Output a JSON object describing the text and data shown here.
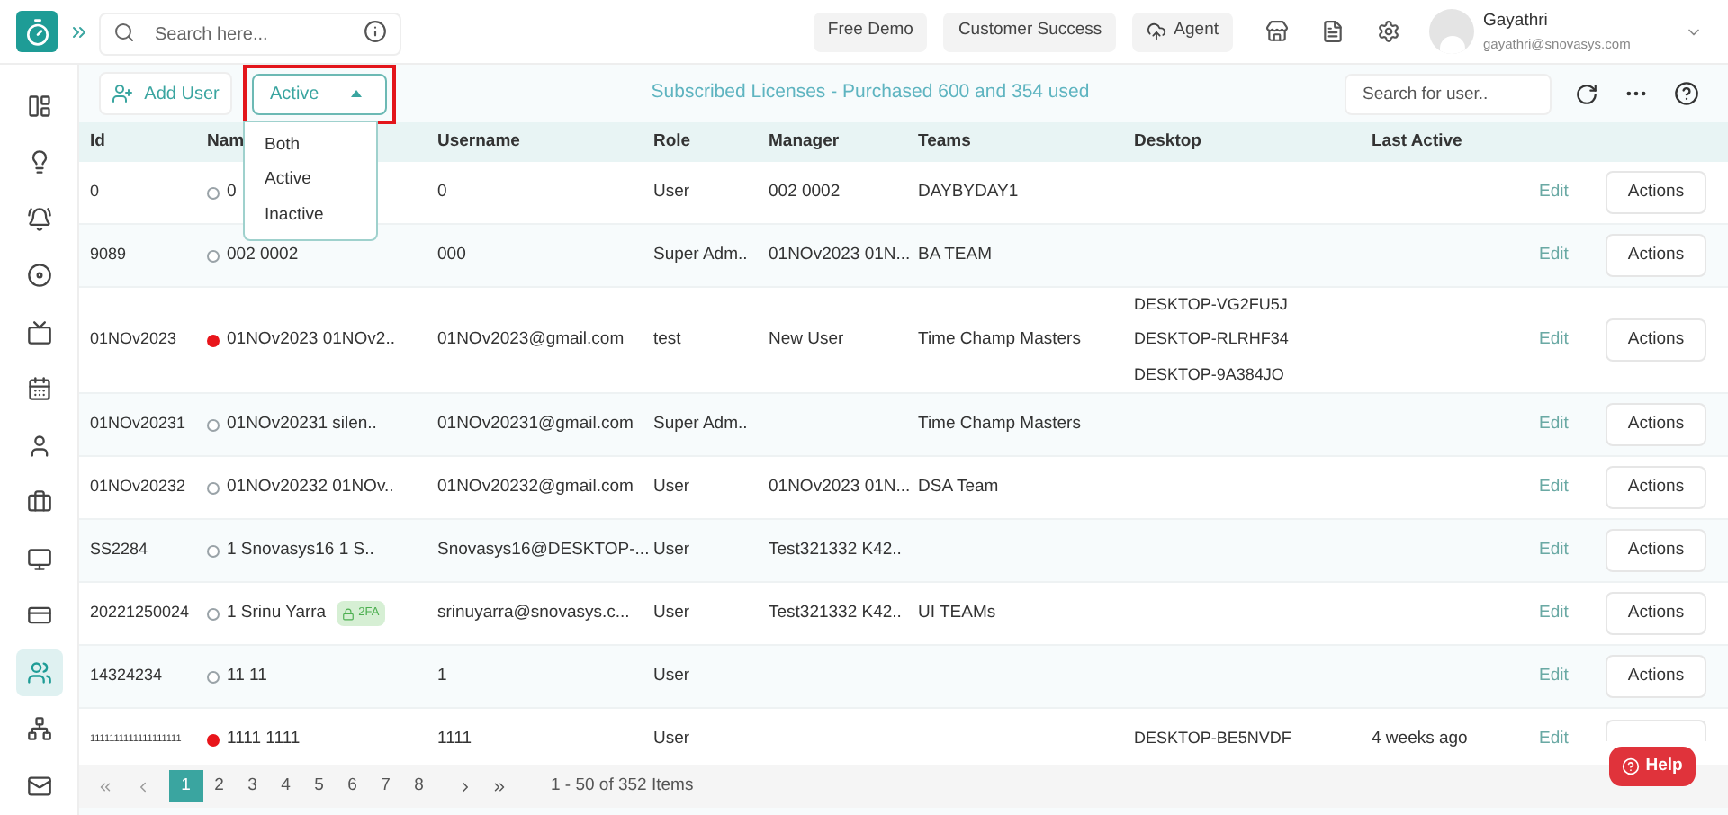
{
  "topbar": {
    "search": {
      "placeholder": "Search here..."
    },
    "buttons": [
      {
        "label": "Free Demo",
        "kind": "plain"
      },
      {
        "label": "Customer Success",
        "kind": "plain"
      },
      {
        "label": "Agent",
        "kind": "cloud"
      }
    ],
    "user": {
      "name": "Gayathri",
      "email": "gayathri@snovasys.com"
    }
  },
  "sidebar": {
    "items": [
      {
        "selected": false
      },
      {
        "selected": false
      },
      {
        "selected": false
      },
      {
        "selected": false
      },
      {
        "selected": false
      },
      {
        "selected": false
      },
      {
        "selected": false
      },
      {
        "selected": false
      },
      {
        "selected": false
      },
      {
        "selected": false
      },
      {
        "selected": true
      },
      {
        "selected": false
      },
      {
        "selected": false
      }
    ]
  },
  "toolbar": {
    "add_user": "Add User",
    "status_select": {
      "value": "Active",
      "options": [
        "Both",
        "Active",
        "Inactive"
      ]
    },
    "licenses": "Subscribed Licenses - Purchased 600 and 354 used",
    "user_search": {
      "placeholder": "Search for user.."
    }
  },
  "table": {
    "columns": [
      "Id",
      "Nam",
      "Username",
      "Role",
      "Manager",
      "Teams",
      "Desktop",
      "Last Active"
    ],
    "rows": [
      {
        "id": "0",
        "online": false,
        "name": "0",
        "username": "0",
        "role": "User",
        "manager": "002 0002",
        "teams": "DAYBYDAY1",
        "desktops": [],
        "last_active": "",
        "edit": "Edit",
        "actions": "Actions"
      },
      {
        "id": "9089",
        "online": false,
        "name": "002 0002",
        "username": "000",
        "role": "Super Adm..",
        "manager": "01NOv2023 01N...",
        "teams": "BA TEAM",
        "desktops": [],
        "last_active": "",
        "edit": "Edit",
        "actions": "Actions"
      },
      {
        "id": "01NOv2023",
        "online": true,
        "name": "01NOv2023 01NOv2..",
        "username": "01NOv2023@gmail.com",
        "role": "test",
        "manager": "New User",
        "teams": "Time Champ Masters",
        "desktops": [
          "DESKTOP-VG2FU5J",
          "DESKTOP-RLRHF34",
          "DESKTOP-9A384JO"
        ],
        "last_active": "",
        "edit": "Edit",
        "actions": "Actions"
      },
      {
        "id": "01NOv20231",
        "online": false,
        "name": "01NOv20231 silen..",
        "username": "01NOv20231@gmail.com",
        "role": "Super Adm..",
        "manager": "",
        "teams": "Time Champ Masters",
        "desktops": [],
        "last_active": "",
        "edit": "Edit",
        "actions": "Actions"
      },
      {
        "id": "01NOv20232",
        "online": false,
        "name": "01NOv20232 01NOv..",
        "username": "01NOv20232@gmail.com",
        "role": "User",
        "manager": "01NOv2023 01N...",
        "teams": "DSA Team",
        "desktops": [],
        "last_active": "",
        "edit": "Edit",
        "actions": "Actions"
      },
      {
        "id": "SS2284",
        "online": false,
        "name": "1 Snovasys16 1 S..",
        "username": "Snovasys16@DESKTOP-...",
        "role": "User",
        "manager": "Test321332 K42..",
        "teams": "",
        "desktops": [],
        "last_active": "",
        "edit": "Edit",
        "actions": "Actions"
      },
      {
        "id": "20221250024",
        "online": false,
        "name": "1 Srinu Yarra",
        "badge": "2FA",
        "username": "srinuyarra@snovasys.c...",
        "role": "User",
        "manager": "Test321332 K42..",
        "teams": "UI TEAMs",
        "desktops": [],
        "last_active": "",
        "edit": "Edit",
        "actions": "Actions"
      },
      {
        "id": "14324234",
        "online": false,
        "name": "11 11",
        "username": "1",
        "role": "User",
        "manager": "",
        "teams": "",
        "desktops": [],
        "last_active": "",
        "edit": "Edit",
        "actions": "Actions"
      },
      {
        "id": "1111111111111111111",
        "online": true,
        "name": "1111 1111",
        "username": "1111",
        "role": "User",
        "manager": "",
        "teams": "",
        "desktops": [
          "DESKTOP-BE5NVDF"
        ],
        "last_active": "4 weeks ago",
        "edit": "Edit",
        "actions": ""
      }
    ]
  },
  "pagination": {
    "pages": [
      {
        "label": "1",
        "selected": true
      },
      {
        "label": "2",
        "selected": false
      },
      {
        "label": "3",
        "selected": false
      },
      {
        "label": "4",
        "selected": false
      },
      {
        "label": "5",
        "selected": false
      },
      {
        "label": "6",
        "selected": false
      },
      {
        "label": "7",
        "selected": false
      },
      {
        "label": "8",
        "selected": false
      }
    ],
    "summary": "1 - 50 of 352 Items"
  },
  "help": "Help"
}
